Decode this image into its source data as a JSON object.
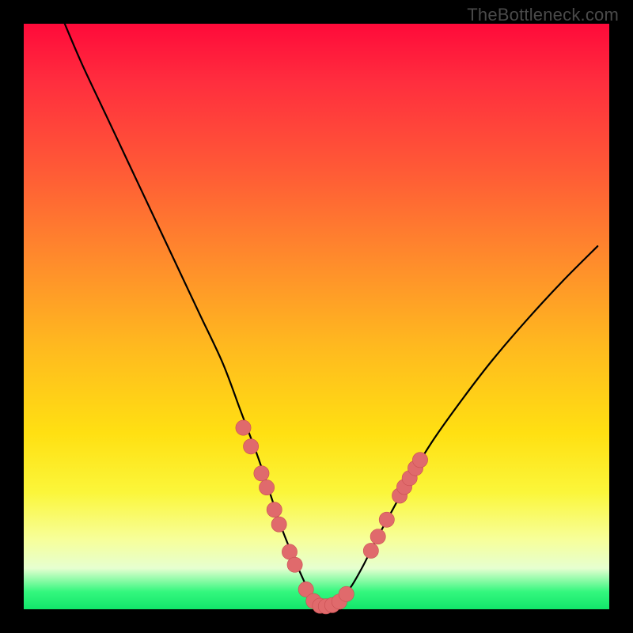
{
  "watermark": "TheBottleneck.com",
  "colors": {
    "bg": "#000000",
    "curve": "#000000",
    "marker_fill": "#e06a6c",
    "marker_stroke": "#c94f52",
    "gradient_stops": [
      "#ff0a3a",
      "#ff5a36",
      "#ffb91f",
      "#ffe012",
      "#f7ff99",
      "#12e56a"
    ]
  },
  "chart_data": {
    "type": "line",
    "title": "",
    "xlabel": "",
    "ylabel": "",
    "xlim": [
      0,
      100
    ],
    "ylim": [
      0,
      100
    ],
    "grid": false,
    "legend": false,
    "series": [
      {
        "name": "bottleneck-curve",
        "x": [
          7,
          10,
          14,
          18,
          22,
          26,
          30,
          34,
          37,
          40,
          42,
          44,
          46,
          48,
          49,
          50,
          52,
          54,
          56,
          58,
          60,
          63,
          66,
          70,
          75,
          80,
          86,
          92,
          98
        ],
        "y": [
          100,
          93,
          84.5,
          76,
          67.5,
          59,
          50.5,
          42,
          34,
          26,
          20,
          14,
          9,
          4.5,
          2,
          0.5,
          0.5,
          1.5,
          4,
          7.5,
          11.5,
          17,
          22.5,
          29,
          36,
          42.5,
          49.5,
          56,
          62
        ]
      }
    ],
    "markers": [
      {
        "x": 37.5,
        "y": 31,
        "r": 1.3
      },
      {
        "x": 38.8,
        "y": 27.8,
        "r": 1.3
      },
      {
        "x": 40.6,
        "y": 23.2,
        "r": 1.3
      },
      {
        "x": 41.5,
        "y": 20.8,
        "r": 1.3
      },
      {
        "x": 42.8,
        "y": 17.0,
        "r": 1.3
      },
      {
        "x": 43.6,
        "y": 14.5,
        "r": 1.3
      },
      {
        "x": 45.4,
        "y": 9.8,
        "r": 1.3
      },
      {
        "x": 46.3,
        "y": 7.6,
        "r": 1.3
      },
      {
        "x": 48.2,
        "y": 3.4,
        "r": 1.3
      },
      {
        "x": 49.5,
        "y": 1.4,
        "r": 1.3
      },
      {
        "x": 50.6,
        "y": 0.6,
        "r": 1.3
      },
      {
        "x": 51.6,
        "y": 0.5,
        "r": 1.3
      },
      {
        "x": 52.7,
        "y": 0.7,
        "r": 1.3
      },
      {
        "x": 53.9,
        "y": 1.3,
        "r": 1.3
      },
      {
        "x": 55.1,
        "y": 2.6,
        "r": 1.3
      },
      {
        "x": 59.3,
        "y": 10.0,
        "r": 1.3
      },
      {
        "x": 60.5,
        "y": 12.4,
        "r": 1.3
      },
      {
        "x": 62.0,
        "y": 15.3,
        "r": 1.3
      },
      {
        "x": 64.2,
        "y": 19.4,
        "r": 1.3
      },
      {
        "x": 65.0,
        "y": 20.9,
        "r": 1.3
      },
      {
        "x": 65.9,
        "y": 22.4,
        "r": 1.3
      },
      {
        "x": 66.9,
        "y": 24.1,
        "r": 1.3
      },
      {
        "x": 67.7,
        "y": 25.5,
        "r": 1.3
      }
    ]
  }
}
